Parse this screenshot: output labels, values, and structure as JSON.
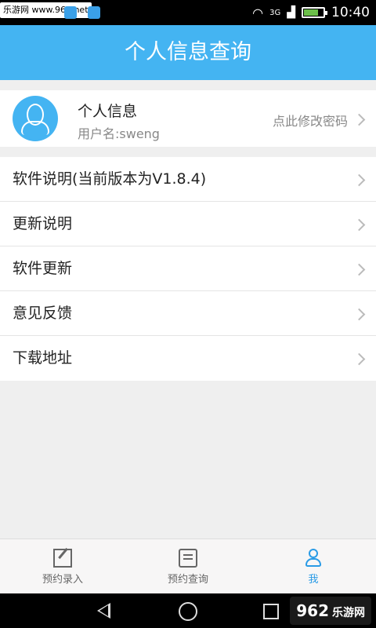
{
  "status_bar": {
    "watermark": "乐游网 www.962.net",
    "network": "3G",
    "time": "10:40"
  },
  "title_bar": {
    "title": "个人信息查询"
  },
  "profile": {
    "name": "个人信息",
    "username": "用户名:sweng",
    "edit_password": "点此修改密码"
  },
  "menu": {
    "items": [
      {
        "label": "软件说明(当前版本为V1.8.4)"
      },
      {
        "label": "更新说明"
      },
      {
        "label": "软件更新"
      },
      {
        "label": "意见反馈"
      },
      {
        "label": "下载地址"
      }
    ]
  },
  "tab_bar": {
    "tabs": [
      {
        "label": "预约录入",
        "icon": "edit-icon"
      },
      {
        "label": "预约查询",
        "icon": "message-icon"
      },
      {
        "label": "我",
        "icon": "user-icon",
        "active": true
      }
    ]
  },
  "watermark_bottom": {
    "logo": "962",
    "sub": "乐游网"
  },
  "colors": {
    "accent": "#44b4f2",
    "active_tab": "#2a9be6"
  }
}
